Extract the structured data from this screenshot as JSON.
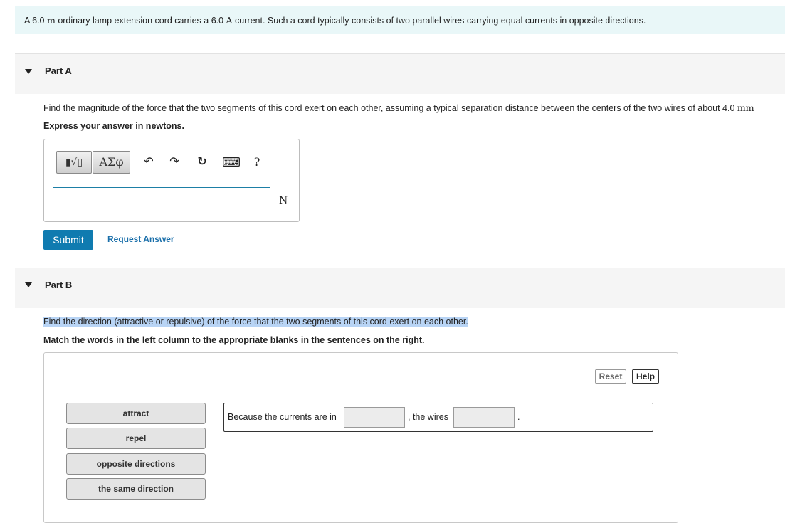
{
  "intro": {
    "text_pre": "A 6.0 ",
    "unit_m": "m",
    "text_mid": " ordinary lamp extension cord carries a 6.0 ",
    "unit_a": "A",
    "text_post": " current. Such a cord typically consists of two parallel wires carrying equal currents in opposite directions."
  },
  "part_a": {
    "title": "Part A",
    "question_pre": "Find the magnitude of the force that the two segments of this cord exert on each other, assuming a typical separation distance between the centers of the two wires of about 4.0 ",
    "question_unit": "mm",
    "instruction": "Express your answer in newtons.",
    "toolbar": {
      "templates_glyph": "▮√▯",
      "symbols_label": "ΑΣφ",
      "undo_glyph": "↶",
      "redo_glyph": "↷",
      "reset_glyph": "↻",
      "keyboard_glyph": "⌨",
      "help_glyph": "?"
    },
    "answer_value": "",
    "unit": "N",
    "submit_label": "Submit",
    "request_label": "Request Answer"
  },
  "part_b": {
    "title": "Part B",
    "question": "Find the direction (attractive or repulsive) of the force that the two segments of this cord exert on each other.",
    "instruction": "Match the words in the left column to the appropriate blanks in the sentences on the right.",
    "reset_label": "Reset",
    "help_label": "Help",
    "chips": [
      "attract",
      "repel",
      "opposite directions",
      "the same direction"
    ],
    "sentence": {
      "part1": "Because the currents are in",
      "part2": ", the wires",
      "part3": "."
    }
  }
}
